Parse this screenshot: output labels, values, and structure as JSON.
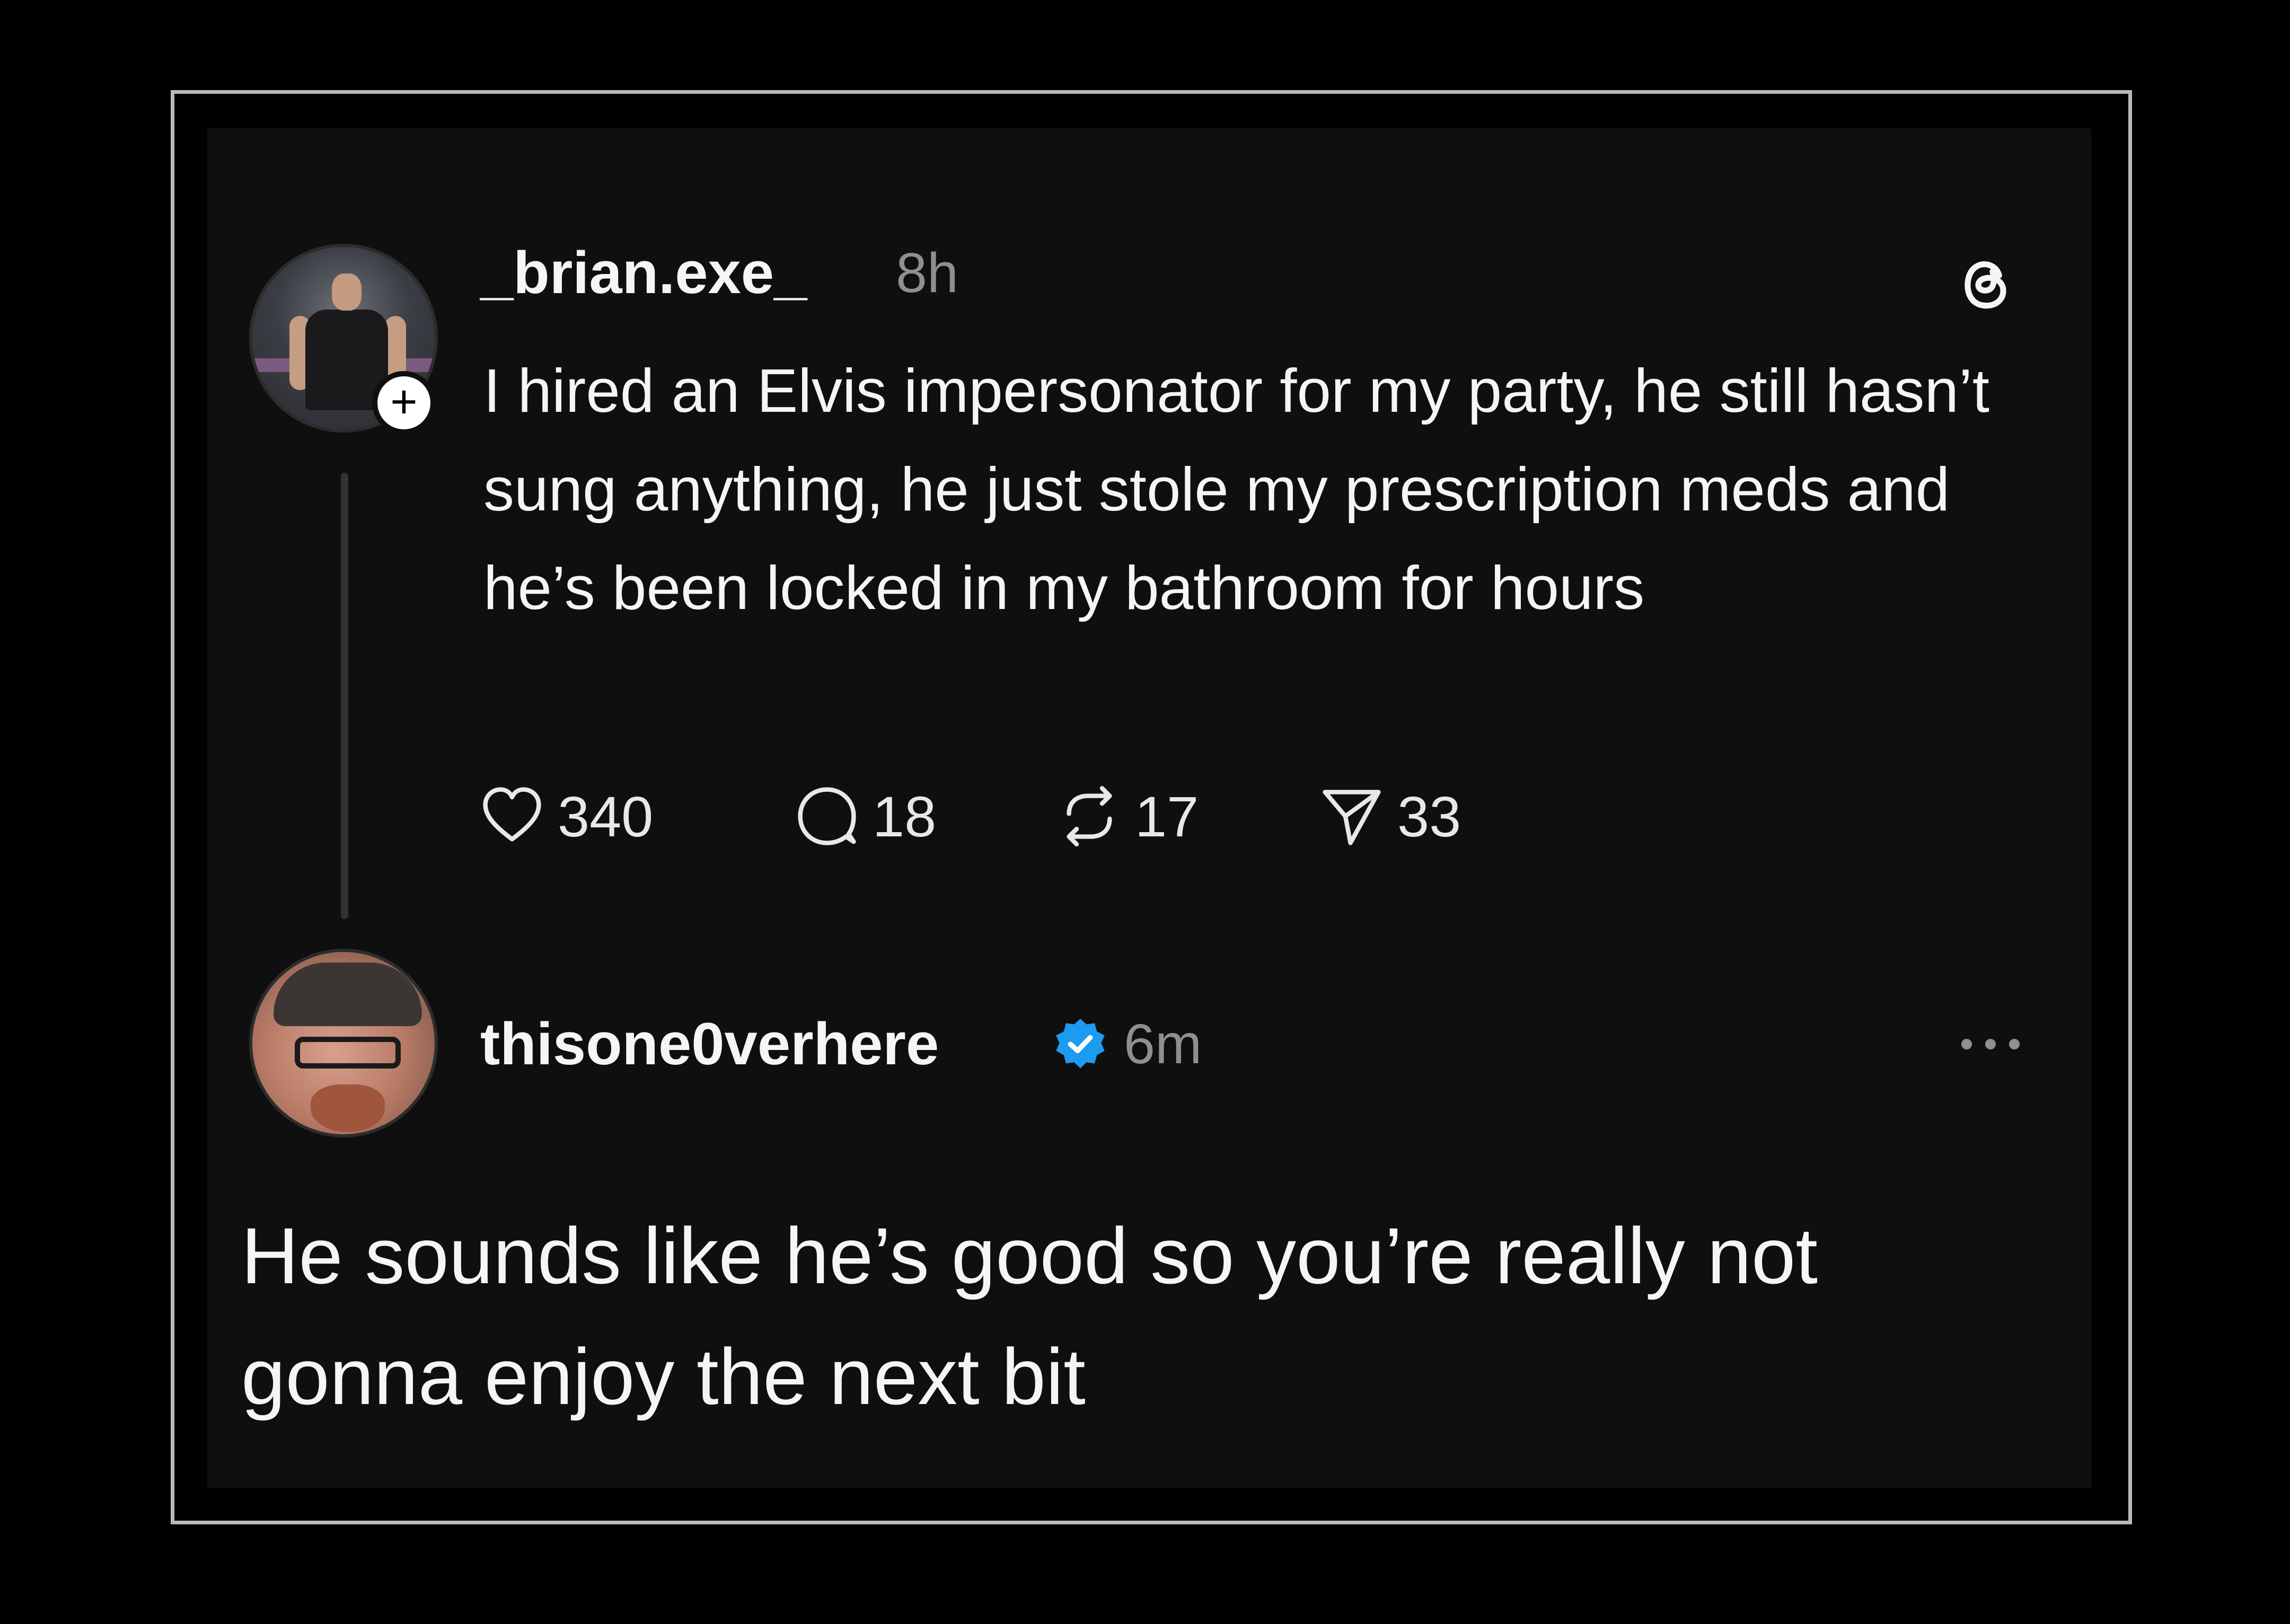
{
  "post": {
    "username": "_brian.exe_",
    "time": "8h",
    "text": "I hired an Elvis impersonator for my party, he still hasn’t sung anything, he just stole my prescription meds and he’s been locked in my bathroom for hours",
    "likes": "340",
    "replies": "18",
    "reposts": "17",
    "shares": "33"
  },
  "reply": {
    "username": "thisone0verhere",
    "time": "6m",
    "text": "He sounds like he’s good so you’re really not gonna enjoy the next bit"
  },
  "icons": {
    "post_avatar": "avatar-photo-icon",
    "follow": "plus-icon",
    "threads": "threads-logo-icon",
    "like": "heart-icon",
    "comment": "comment-bubble-icon",
    "repost": "repost-icon",
    "share": "send-icon",
    "verified": "verified-badge-icon",
    "more": "more-dots-icon"
  },
  "colors": {
    "background": "#0f0f0f",
    "text": "#f3f5f7",
    "muted": "#8f8f8f",
    "verified": "#1d9bf0",
    "frame": "#b9b9b9"
  }
}
